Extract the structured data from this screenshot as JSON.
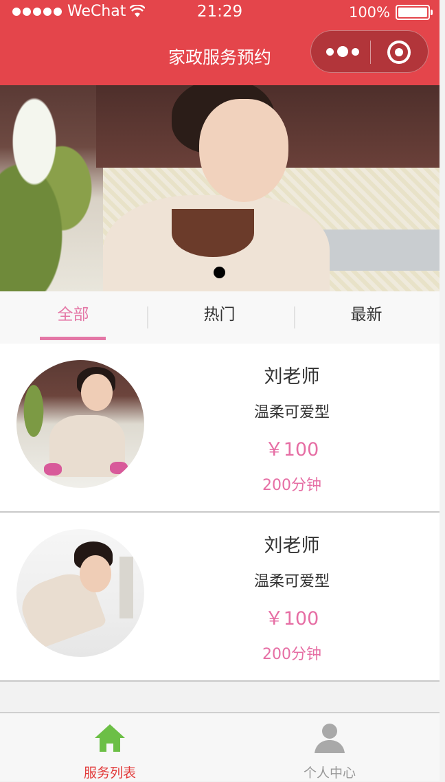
{
  "status_bar": {
    "carrier": "WeChat",
    "time": "21:29",
    "battery": "100%"
  },
  "nav": {
    "title": "家政服务预约"
  },
  "tabs": [
    {
      "label": "全部"
    },
    {
      "label": "热门"
    },
    {
      "label": "最新"
    }
  ],
  "services": [
    {
      "name": "刘老师",
      "type": "温柔可爱型",
      "price": "￥100",
      "duration": "200分钟"
    },
    {
      "name": "刘老师",
      "type": "温柔可爱型",
      "price": "￥100",
      "duration": "200分钟"
    }
  ],
  "tabbar": {
    "items": [
      {
        "label": "服务列表",
        "icon": "home-icon"
      },
      {
        "label": "个人中心",
        "icon": "user-icon"
      }
    ]
  },
  "colors": {
    "brand": "#e4454b",
    "accent": "#e477a6",
    "tabbar_active": "#e23a3a",
    "tabbar_inactive": "#999999",
    "home_icon": "#6cbf46"
  }
}
